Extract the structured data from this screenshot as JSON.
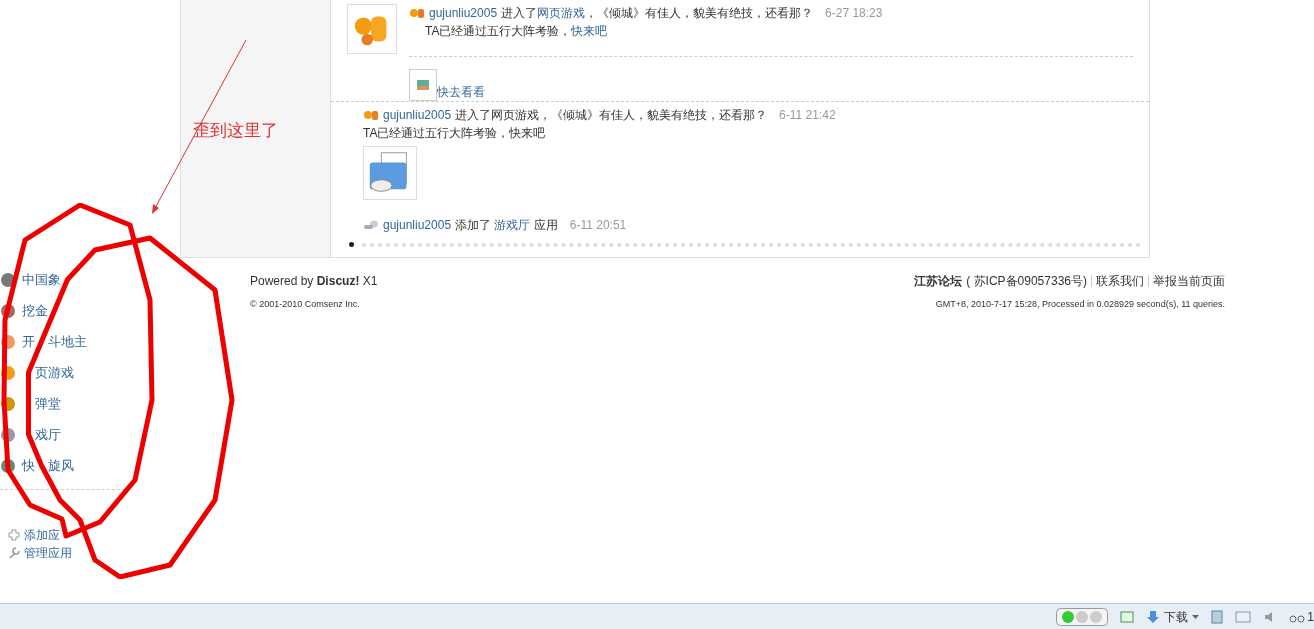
{
  "feed": [
    {
      "kind": "game",
      "user": "gujunliu2005",
      "verb": "进入了",
      "link": "网页游戏",
      "rest": "，《倾城》有佳人，貌美有绝技，还看那？",
      "time": "6-27 18:23",
      "body": "TA已经通过五行大阵考验，",
      "body_link": "快来吧",
      "thumb_link": "快去看看"
    },
    {
      "kind": "plain",
      "user": "gujunliu2005",
      "text": "进入了网页游戏，《倾城》有佳人，貌美有绝技，还看那？",
      "time": "6-11 21:42",
      "body": "TA已经通过五行大阵考验，快来吧"
    },
    {
      "kind": "app",
      "user": "gujunliu2005",
      "verb": "添加了",
      "link": "游戏厅",
      "rest": "应用",
      "time": "6-11 20:51"
    }
  ],
  "annotation": {
    "text": "歪到这里了"
  },
  "apps": [
    {
      "segments": [
        {
          "kind": "text",
          "text": "中国象"
        }
      ]
    },
    {
      "segments": [
        {
          "kind": "text",
          "text": "挖金"
        }
      ]
    },
    {
      "segments": [
        {
          "kind": "text",
          "text": "开"
        },
        {
          "kind": "gap"
        },
        {
          "kind": "text",
          "text": "斗地主"
        }
      ]
    },
    {
      "segments": [
        {
          "kind": "gap"
        },
        {
          "kind": "text",
          "text": "页游戏"
        }
      ]
    },
    {
      "segments": [
        {
          "kind": "gap"
        },
        {
          "kind": "text",
          "text": "弹堂"
        }
      ]
    },
    {
      "segments": [
        {
          "kind": "gap"
        },
        {
          "kind": "text",
          "text": "戏厅"
        }
      ]
    },
    {
      "segments": [
        {
          "kind": "text",
          "text": "快"
        },
        {
          "kind": "gap"
        },
        {
          "kind": "text",
          "text": "旋风"
        }
      ]
    }
  ],
  "app_actions": [
    {
      "kind": "add",
      "label": "添加应"
    },
    {
      "kind": "manage",
      "label": "管理应用"
    }
  ],
  "footer": {
    "powered": "Powered by **Discuz!** X1",
    "copyright": "© 2001-2010 Comsenz Inc.",
    "site": "江苏论坛",
    "icp": "( 苏ICP备09057336号)",
    "links": [
      "联系我们",
      "举报当前页面"
    ],
    "stats": "GMT+8, 2010-7-17 15:28, Processed in 0.028929 second(s), 11 queries."
  },
  "status_bar": {
    "download": "下载",
    "cut_text": "1"
  }
}
